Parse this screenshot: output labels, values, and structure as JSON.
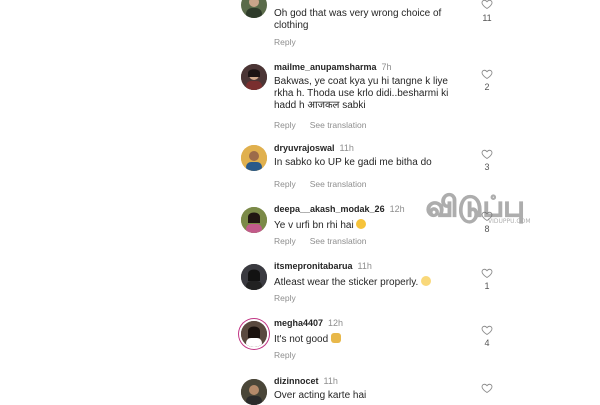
{
  "comments": [
    {
      "username": "",
      "time": "",
      "text": "Oh god that was very wrong choice of clothing",
      "reply": "Reply",
      "see_translation": "",
      "likes": "11",
      "avatar_color": "#5a6b4a"
    },
    {
      "username": "mailme_anupamsharma",
      "time": "7h",
      "text": "Bakwas, ye coat kya yu hi tangne k liye rkha h. Thoda use krlo didi..besharmi ki hadd h आजकल sabki",
      "reply": "Reply",
      "see_translation": "See translation",
      "likes": "2",
      "avatar_color": "#3b2a2a"
    },
    {
      "username": "dryuvrajoswal",
      "time": "11h",
      "text": "In sabko ko UP ke gadi me bitha do",
      "reply": "Reply",
      "see_translation": "See translation",
      "likes": "3",
      "avatar_color": "#d9a441"
    },
    {
      "username": "deepa__akash_modak_26",
      "time": "12h",
      "text": "Ye v urfi bn rhi hai",
      "reply": "Reply",
      "see_translation": "See translation",
      "likes": "8",
      "avatar_color": "#6b7a3a"
    },
    {
      "username": "itsmepronitabarua",
      "time": "11h",
      "text": "Atleast wear the sticker properly.",
      "reply": "Reply",
      "see_translation": "",
      "likes": "1",
      "avatar_color": "#2f2f35"
    },
    {
      "username": "megha4407",
      "time": "12h",
      "text": "It's not good",
      "reply": "Reply",
      "see_translation": "",
      "likes": "4",
      "avatar_color": "#4a3b33"
    },
    {
      "username": "dizinnocet",
      "time": "11h",
      "text": "Over acting karte hai",
      "reply": "",
      "see_translation": "",
      "likes": "",
      "avatar_color": "#3d3a30"
    }
  ],
  "watermark": {
    "text": "விடுப்பு",
    "sub": "VIDUPPU.COM"
  },
  "colors": {
    "text": "#262626",
    "secondary": "#8e8e8e",
    "story_ring": "#c13584"
  }
}
